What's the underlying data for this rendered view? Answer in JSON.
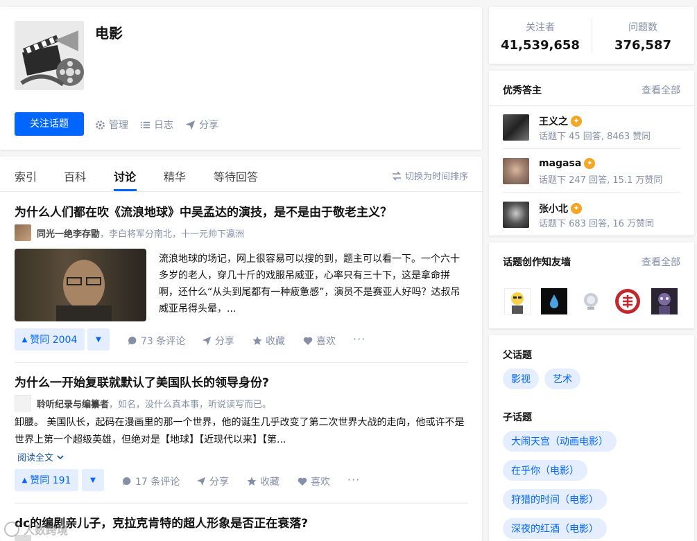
{
  "topic": {
    "title": "电影",
    "follow_label": "关注话题",
    "manage_label": "管理",
    "log_label": "日志",
    "share_label": "分享"
  },
  "stats": {
    "followers_label": "关注者",
    "followers_value": "41,539,658",
    "questions_label": "问题数",
    "questions_value": "376,587"
  },
  "tabs": [
    "索引",
    "百科",
    "讨论",
    "精华",
    "等待回答"
  ],
  "sort_toggle": "切换为时间排序",
  "feed": [
    {
      "question": "为什么人们都在吹《流浪地球》中吴孟达的演技，是不是由于敬老主义？",
      "author": "同光一绝李存勖",
      "author_bio": "，李白将军分南北，十一元帅下瀛洲",
      "excerpt": "流浪地球的场记，网上很容易可以搜的到，题主可以看一下。一个六十多岁的老人，穿几十斤的戏服吊威亚，心率只有三十下，这是拿命拼啊，还什么“从头到尾都有一种疲惫感”，演员不是赛亚人好吗？达叔吊威亚吊得头晕，...",
      "vote_label": "赞同 2004",
      "comments": "73 条评论",
      "share": "分享",
      "favorite": "收藏",
      "like": "喜欢"
    },
    {
      "question": "为什么一开始复联就默认了美国队长的领导身份?",
      "author": "聆听纪录与编纂者",
      "author_bio": "，如名，没什么真本事，听说读写而已。",
      "excerpt": "卸腰。 美国队长，起码在漫画里的那一个世界，他的诞生几乎改变了第二次世界大战的走向，他或许不是世界上第一个超级英雄，但绝对是【地球】【近现代以来】【第...",
      "read_more": "阅读全文",
      "vote_label": "赞同 191",
      "comments": "17 条评论",
      "share": "分享",
      "favorite": "收藏",
      "like": "喜欢"
    },
    {
      "question": "dc的编剧亲儿子，克拉克肯特的超人形象是否正在衰落?"
    }
  ],
  "top_answerers": {
    "title": "优秀答主",
    "view_all": "查看全部",
    "items": [
      {
        "name": "王义之",
        "meta": "话题下 45 回答, 8463 赞同"
      },
      {
        "name": "magasa",
        "meta": "话题下 247 回答, 15.1 万赞同"
      },
      {
        "name": "张小北",
        "meta": "话题下 683 回答, 16 万赞同"
      }
    ]
  },
  "creators": {
    "title": "话题创作知友墙",
    "view_all": "查看全部"
  },
  "parent_topics": {
    "title": "父话题",
    "items": [
      "影视",
      "艺术"
    ]
  },
  "child_topics": {
    "title": "子话题",
    "items": [
      "大闹天宫（动画电影）",
      "在乎你（电影）",
      "狩猎的时间（电影）",
      "深夜的红酒（电影）"
    ]
  },
  "watermark": "人数跨境"
}
